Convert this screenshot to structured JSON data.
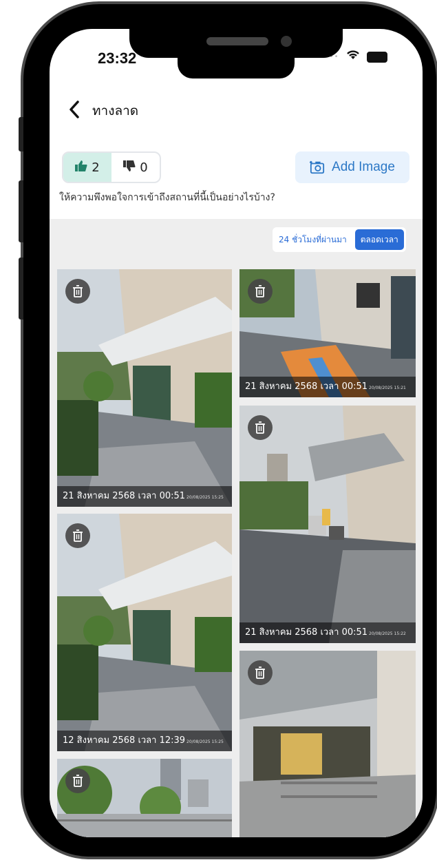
{
  "status_bar": {
    "time": "23:32",
    "signal": "•••••"
  },
  "header": {
    "title": "ทางลาด"
  },
  "votes": {
    "like_count": "2",
    "dislike_count": "0"
  },
  "add_image_label": "Add Image",
  "question": "ให้ความพึงพอใจการเข้าถึงสถานที่นี้เป็นอย่างไรบ้าง?",
  "filter": {
    "options": [
      "24 ชั่วโมงที่ผ่านมา",
      "ตลอดเวลา"
    ],
    "selected": "ตลอดเวลา"
  },
  "photos": [
    {
      "caption": "21 สิงหาคม 2568 เวลา 00:51",
      "stamp": "20/08/2025 15:25"
    },
    {
      "caption": "21 สิงหาคม 2568 เวลา 00:51",
      "stamp": "20/08/2025 15:21"
    },
    {
      "caption": "21 สิงหาคม 2568 เวลา 00:51",
      "stamp": "20/08/2025 15:22"
    },
    {
      "caption": "12 สิงหาคม 2568 เวลา 12:39",
      "stamp": "20/08/2025 15:25"
    },
    {
      "caption": ""
    },
    {
      "caption": ""
    }
  ],
  "colors": {
    "accent": "#2a6cd6",
    "like_bg": "#d3efe8",
    "add_bg": "#e8f2fd"
  }
}
